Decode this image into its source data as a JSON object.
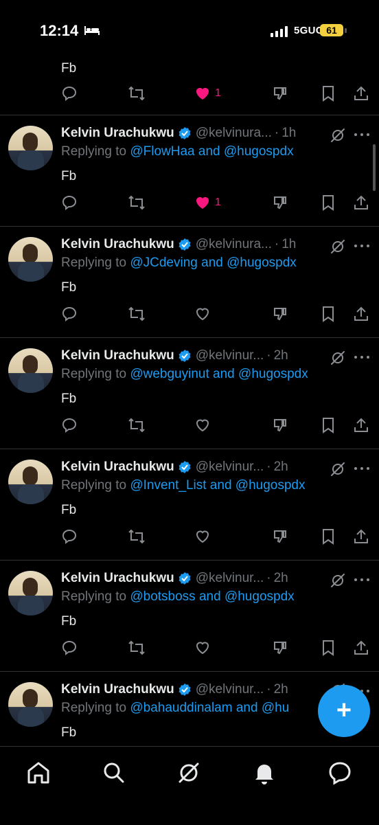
{
  "status_bar": {
    "time": "12:14",
    "network": "5GUC",
    "battery": "61"
  },
  "colors": {
    "accent": "#1d9bf0",
    "like": "#f91880",
    "muted": "#71767b",
    "background": "#000000"
  },
  "first_partial_tweet": {
    "text": "Fb",
    "likes": "1"
  },
  "tweets": [
    {
      "name": "Kelvin Urachukwu",
      "handle": "@kelvinura...",
      "time": "1h",
      "replying_prefix": "Replying to ",
      "mention1": "@FlowHaa",
      "and": " and ",
      "mention2": "@hugospdx",
      "text": "Fb",
      "liked": true,
      "likes": "1"
    },
    {
      "name": "Kelvin Urachukwu",
      "handle": "@kelvinura...",
      "time": "1h",
      "replying_prefix": "Replying to ",
      "mention1": "@JCdeving",
      "and": " and ",
      "mention2": "@hugospdx",
      "text": "Fb",
      "liked": false,
      "likes": ""
    },
    {
      "name": "Kelvin Urachukwu",
      "handle": "@kelvinur...",
      "time": "2h",
      "replying_prefix": "Replying to ",
      "mention1": "@webguyinut",
      "and": " and ",
      "mention2": "@hugospdx",
      "text": "Fb",
      "liked": false,
      "likes": ""
    },
    {
      "name": "Kelvin Urachukwu",
      "handle": "@kelvinur...",
      "time": "2h",
      "replying_prefix": "Replying to ",
      "mention1": "@Invent_List",
      "and": " and ",
      "mention2": "@hugospdx",
      "text": "Fb",
      "liked": false,
      "likes": ""
    },
    {
      "name": "Kelvin Urachukwu",
      "handle": "@kelvinur...",
      "time": "2h",
      "replying_prefix": "Replying to ",
      "mention1": "@botsboss",
      "and": " and ",
      "mention2": "@hugospdx",
      "text": "Fb",
      "liked": false,
      "likes": ""
    },
    {
      "name": "Kelvin Urachukwu",
      "handle": "@kelvinur...",
      "time": "2h",
      "replying_prefix": "Replying to ",
      "mention1": "@bahauddinalam",
      "and": " and ",
      "mention2": "@hu",
      "text": "Fb",
      "liked": false,
      "likes": ""
    }
  ],
  "fab": {
    "label": "+"
  },
  "nav": [
    "home-icon",
    "search-icon",
    "grok-icon",
    "notifications-icon",
    "messages-icon"
  ]
}
